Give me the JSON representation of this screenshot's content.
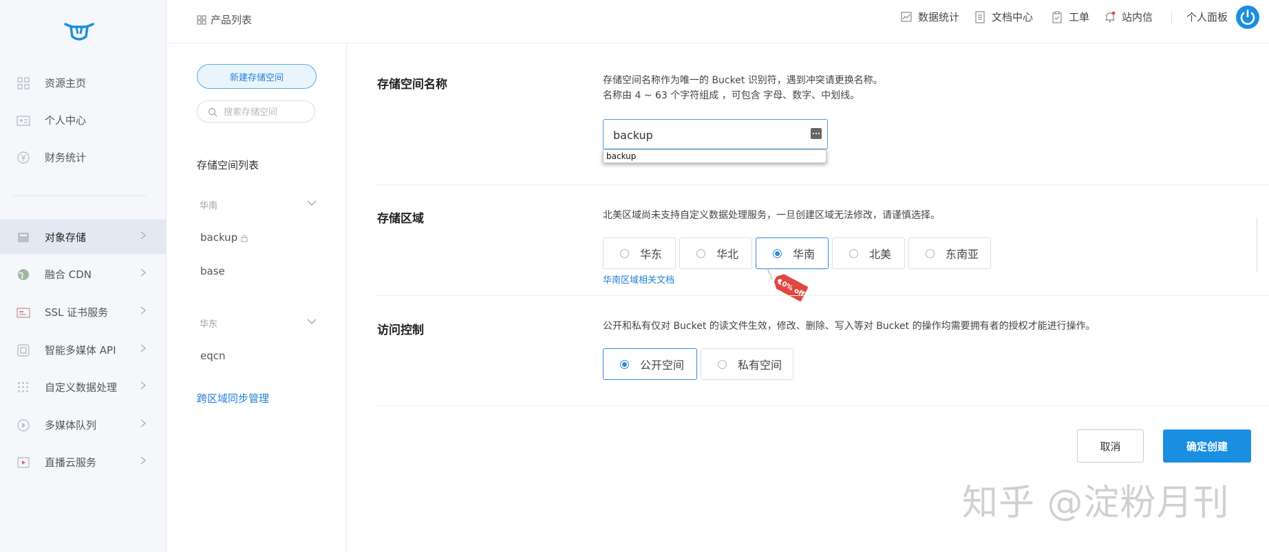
{
  "colors": {
    "accent": "#1a8ee0",
    "nav_bg": "#f5f7fa",
    "nav_active_bg": "#e3e9f2",
    "link": "#1f7fd6"
  },
  "sidebar": {
    "items": [
      {
        "label": "资源主页",
        "icon": "home-grid-icon"
      },
      {
        "label": "个人中心",
        "icon": "id-card-icon"
      },
      {
        "label": "财务统计",
        "icon": "yen-icon"
      },
      {
        "label": "对象存储",
        "icon": "storage-icon",
        "active": true
      },
      {
        "label": "融合 CDN",
        "icon": "globe-icon"
      },
      {
        "label": "SSL 证书服务",
        "icon": "certificate-icon"
      },
      {
        "label": "智能多媒体 API",
        "icon": "media-api-icon"
      },
      {
        "label": "自定义数据处理",
        "icon": "data-process-icon"
      },
      {
        "label": "多媒体队列",
        "icon": "queue-icon"
      },
      {
        "label": "直播云服务",
        "icon": "live-icon"
      }
    ]
  },
  "header": {
    "product_list": "产品列表",
    "nav": [
      {
        "label": "数据统计",
        "icon": "chart-icon"
      },
      {
        "label": "文档中心",
        "icon": "document-icon"
      },
      {
        "label": "工单",
        "icon": "clipboard-icon"
      },
      {
        "label": "站内信",
        "icon": "bell-icon"
      }
    ],
    "personal_panel": "个人面板"
  },
  "panel": {
    "new_bucket": "新建存储空间",
    "search_placeholder": "搜索存储空间",
    "list_title": "存储空间列表",
    "regions": [
      {
        "name": "华南",
        "buckets": [
          "backup"
        ]
      },
      {
        "name": "华东",
        "buckets": [
          "base",
          "eqcn"
        ]
      }
    ],
    "cross_region": "跨区域同步管理"
  },
  "form": {
    "name": {
      "label": "存储空间名称",
      "desc1": "存储空间名称作为唯一的 Bucket 识别符，遇到冲突请更换名称。",
      "desc2": "名称由 4 ~ 63 个字符组成 ，可包含 字母、数字、中划线。",
      "value": "backup",
      "autocomplete": "backup"
    },
    "region": {
      "label": "存储区域",
      "desc": "北美区域尚未支持自定义数据处理服务，一旦创建区域无法修改，请谨慎选择。",
      "options": [
        "华东",
        "华北",
        "华南",
        "北美",
        "东南亚"
      ],
      "selected": "华南",
      "doc_link": "华南区域相关文档",
      "promo": "10% off"
    },
    "access": {
      "label": "访问控制",
      "desc": "公开和私有仅对 Bucket 的读文件生效，修改、删除、写入等对 Bucket 的操作均需要拥有者的授权才能进行操作。",
      "options": [
        "公开空间",
        "私有空间"
      ],
      "selected": "公开空间"
    },
    "cancel": "取消",
    "confirm": "确定创建"
  },
  "watermark": "知乎 @淀粉月刊"
}
